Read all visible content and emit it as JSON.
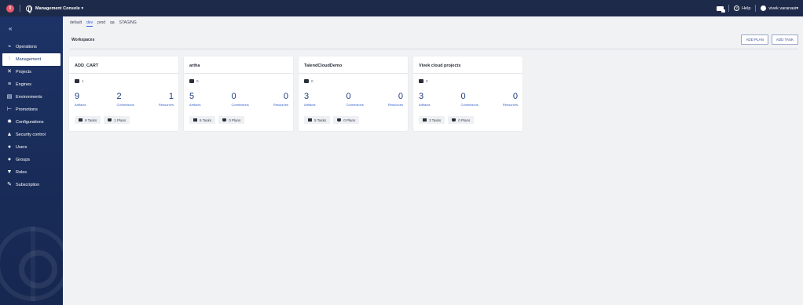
{
  "topbar": {
    "logo_letter": "t",
    "app_title": "Management Console",
    "title_caret": "▾",
    "help_label": "Help",
    "user_name": "vivek varanasi",
    "user_caret": "▾"
  },
  "sidebar": {
    "collapse": "«",
    "items": [
      {
        "label": "Operations",
        "icon": "pulse-icon",
        "glyph": "⌁",
        "active": false
      },
      {
        "label": "Management",
        "icon": "sliders-icon",
        "glyph": "⫶",
        "active": true
      },
      {
        "label": "Projects",
        "icon": "tools-icon",
        "glyph": "✕",
        "active": false
      },
      {
        "label": "Engines",
        "icon": "list-icon",
        "glyph": "≡",
        "active": false
      },
      {
        "label": "Environments",
        "icon": "window-icon",
        "glyph": "▤",
        "active": false
      },
      {
        "label": "Promotions",
        "icon": "promote-icon",
        "glyph": "⊢",
        "active": false
      },
      {
        "label": "Configurations",
        "icon": "gear-icon",
        "glyph": "✹",
        "active": false
      },
      {
        "label": "Security control",
        "icon": "lock-icon",
        "glyph": "▲",
        "active": false
      },
      {
        "label": "Users",
        "icon": "user-icon",
        "glyph": "●",
        "active": false
      },
      {
        "label": "Groups",
        "icon": "group-icon",
        "glyph": "●",
        "active": false
      },
      {
        "label": "Roles",
        "icon": "role-icon",
        "glyph": "▼",
        "active": false
      },
      {
        "label": "Subscription",
        "icon": "key-icon",
        "glyph": "✎",
        "active": false
      }
    ]
  },
  "env_tabs": [
    {
      "label": "default",
      "active": false
    },
    {
      "label": "dev",
      "active": true
    },
    {
      "label": "prod",
      "active": false
    },
    {
      "label": "qa",
      "active": false
    },
    {
      "label": "STAGING",
      "active": false
    }
  ],
  "workspaces": {
    "title": "Workspaces",
    "add_plan": "ADD PLAN",
    "add_task": "ADD TASK",
    "cards": [
      {
        "title": "ADD_CART",
        "count": "1",
        "artifacts": "9",
        "connections": "2",
        "resources": "1",
        "tasks": "9 Tasks",
        "plans": "1 Plans"
      },
      {
        "title": "artha",
        "count": "0",
        "artifacts": "5",
        "connections": "0",
        "resources": "0",
        "tasks": "6 Tasks",
        "plans": "0 Plans"
      },
      {
        "title": "TalendCloudDemo",
        "count": "0",
        "artifacts": "3",
        "connections": "0",
        "resources": "0",
        "tasks": "5 Tasks",
        "plans": "0 Plans"
      },
      {
        "title": "Vivek cloud projects",
        "count": "0",
        "artifacts": "3",
        "connections": "0",
        "resources": "0",
        "tasks": "3 Tasks",
        "plans": "0 Plans"
      }
    ],
    "labels": {
      "artifacts": "Artifacts",
      "connections": "Connections",
      "resources": "Resources"
    }
  }
}
